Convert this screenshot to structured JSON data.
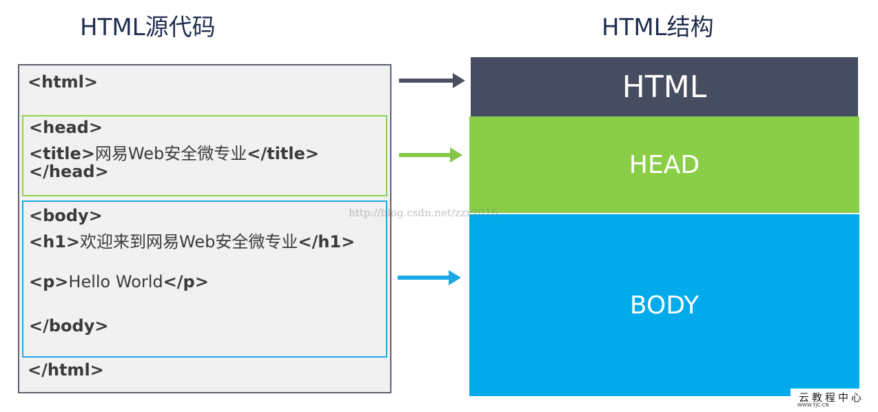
{
  "titles": {
    "left": "HTML源代码",
    "right": "HTML结构"
  },
  "code": {
    "html_open": {
      "tag": "<html>"
    },
    "head_open": {
      "tag": "<head>"
    },
    "title_line": {
      "open": "<title>",
      "text": "网易Web安全微专业",
      "close": "</title>"
    },
    "head_close": {
      "tag": "</head>"
    },
    "body_open": {
      "tag": "<body>"
    },
    "h1_line": {
      "open": "<h1>",
      "text": "欢迎来到网易Web安全微专业",
      "close": "</h1>"
    },
    "p_line": {
      "open": "<p>",
      "text": "Hello World",
      "close": "</p>"
    },
    "body_close": {
      "tag": "</body>"
    },
    "html_close": {
      "tag": "</html>"
    }
  },
  "structure": {
    "html": "HTML",
    "head": "HEAD",
    "body": "BODY"
  },
  "colors": {
    "html": "#474d60",
    "head": "#8ace47",
    "body": "#00aaeb"
  },
  "watermark": "http://blog.csdn.net/zzx2016",
  "logo": {
    "main": "云教程中心",
    "sub": "WWW.YJC.CN"
  }
}
